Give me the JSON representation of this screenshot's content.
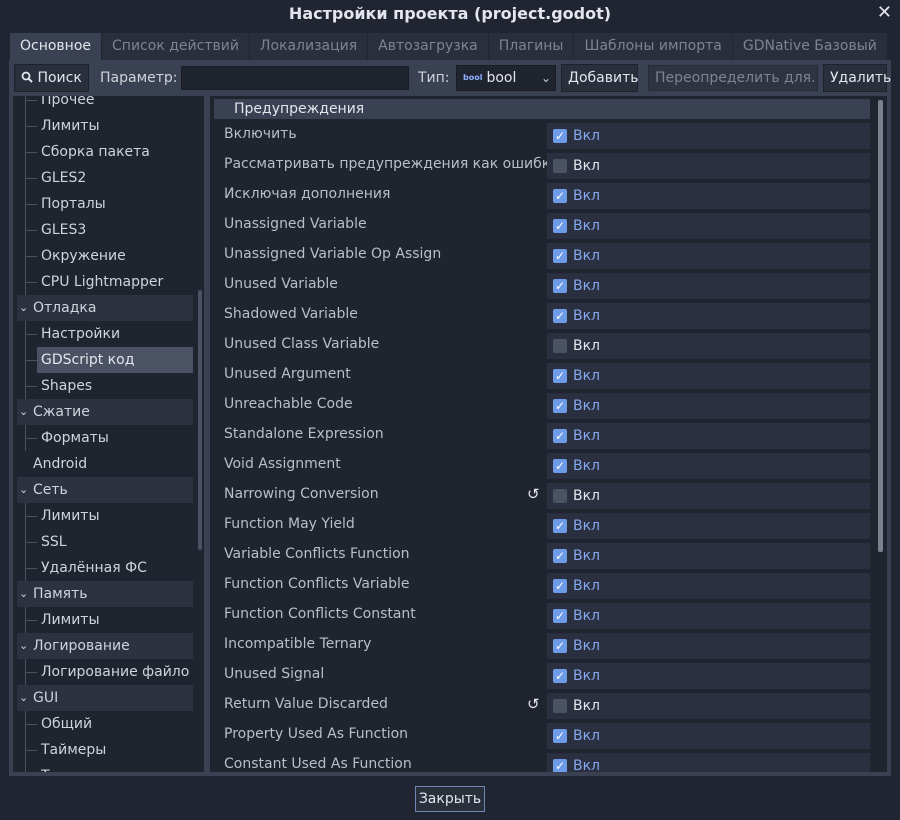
{
  "window": {
    "title": "Настройки проекта (project.godot)",
    "close_glyph": "✕"
  },
  "tabs": [
    {
      "label": "Основное"
    },
    {
      "label": "Список действий"
    },
    {
      "label": "Локализация"
    },
    {
      "label": "Автозагрузка"
    },
    {
      "label": "Плагины"
    },
    {
      "label": "Шаблоны импорта"
    },
    {
      "label": "GDNative Базовый"
    }
  ],
  "toolbar": {
    "search_label": "Поиск",
    "search_icon": "search-icon",
    "param_label": "Параметр:",
    "param_value": "",
    "type_label": "Тип:",
    "type_icon": "bool",
    "type_value": "bool",
    "add_label": "Добавить",
    "override_label": "Переопределить для...",
    "delete_label": "Удалить"
  },
  "tree": [
    {
      "label": "Прочее",
      "kind": "child"
    },
    {
      "label": "Лимиты",
      "kind": "child"
    },
    {
      "label": "Сборка пакета",
      "kind": "child"
    },
    {
      "label": "GLES2",
      "kind": "child"
    },
    {
      "label": "Порталы",
      "kind": "child"
    },
    {
      "label": "GLES3",
      "kind": "child"
    },
    {
      "label": "Окружение",
      "kind": "child"
    },
    {
      "label": "CPU Lightmapper",
      "kind": "child"
    },
    {
      "label": "Отладка",
      "kind": "section"
    },
    {
      "label": "Настройки",
      "kind": "child"
    },
    {
      "label": "GDScript код",
      "kind": "child",
      "selected": true
    },
    {
      "label": "Shapes",
      "kind": "child"
    },
    {
      "label": "Сжатие",
      "kind": "section"
    },
    {
      "label": "Форматы",
      "kind": "child"
    },
    {
      "label": "Android",
      "kind": "plain"
    },
    {
      "label": "Сеть",
      "kind": "section"
    },
    {
      "label": "Лимиты",
      "kind": "child"
    },
    {
      "label": "SSL",
      "kind": "child"
    },
    {
      "label": "Удалённая ФС",
      "kind": "child"
    },
    {
      "label": "Память",
      "kind": "section"
    },
    {
      "label": "Лимиты",
      "kind": "child"
    },
    {
      "label": "Логирование",
      "kind": "section"
    },
    {
      "label": "Логирование файло",
      "kind": "child"
    },
    {
      "label": "GUI",
      "kind": "section"
    },
    {
      "label": "Общий",
      "kind": "child"
    },
    {
      "label": "Таймеры",
      "kind": "child"
    },
    {
      "label": "Тема",
      "kind": "child"
    }
  ],
  "inspector": {
    "category": "Предупреждения",
    "on_text": "Вкл",
    "revert_glyph": "↺",
    "properties": [
      {
        "name": "Включить",
        "checked": true,
        "revert": false
      },
      {
        "name": "Рассматривать предупреждения как ошибки",
        "checked": false,
        "revert": false
      },
      {
        "name": "Исключая дополнения",
        "checked": true,
        "revert": false
      },
      {
        "name": "Unassigned Variable",
        "checked": true,
        "revert": false
      },
      {
        "name": "Unassigned Variable Op Assign",
        "checked": true,
        "revert": false
      },
      {
        "name": "Unused Variable",
        "checked": true,
        "revert": false
      },
      {
        "name": "Shadowed Variable",
        "checked": true,
        "revert": false
      },
      {
        "name": "Unused Class Variable",
        "checked": false,
        "revert": false
      },
      {
        "name": "Unused Argument",
        "checked": true,
        "revert": false
      },
      {
        "name": "Unreachable Code",
        "checked": true,
        "revert": false
      },
      {
        "name": "Standalone Expression",
        "checked": true,
        "revert": false
      },
      {
        "name": "Void Assignment",
        "checked": true,
        "revert": false
      },
      {
        "name": "Narrowing Conversion",
        "checked": false,
        "revert": true
      },
      {
        "name": "Function May Yield",
        "checked": true,
        "revert": false
      },
      {
        "name": "Variable Conflicts Function",
        "checked": true,
        "revert": false
      },
      {
        "name": "Function Conflicts Variable",
        "checked": true,
        "revert": false
      },
      {
        "name": "Function Conflicts Constant",
        "checked": true,
        "revert": false
      },
      {
        "name": "Incompatible Ternary",
        "checked": true,
        "revert": false
      },
      {
        "name": "Unused Signal",
        "checked": true,
        "revert": false
      },
      {
        "name": "Return Value Discarded",
        "checked": false,
        "revert": true
      },
      {
        "name": "Property Used As Function",
        "checked": true,
        "revert": false
      },
      {
        "name": "Constant Used As Function",
        "checked": true,
        "revert": false
      }
    ]
  },
  "footer": {
    "close_label": "Закрыть"
  }
}
